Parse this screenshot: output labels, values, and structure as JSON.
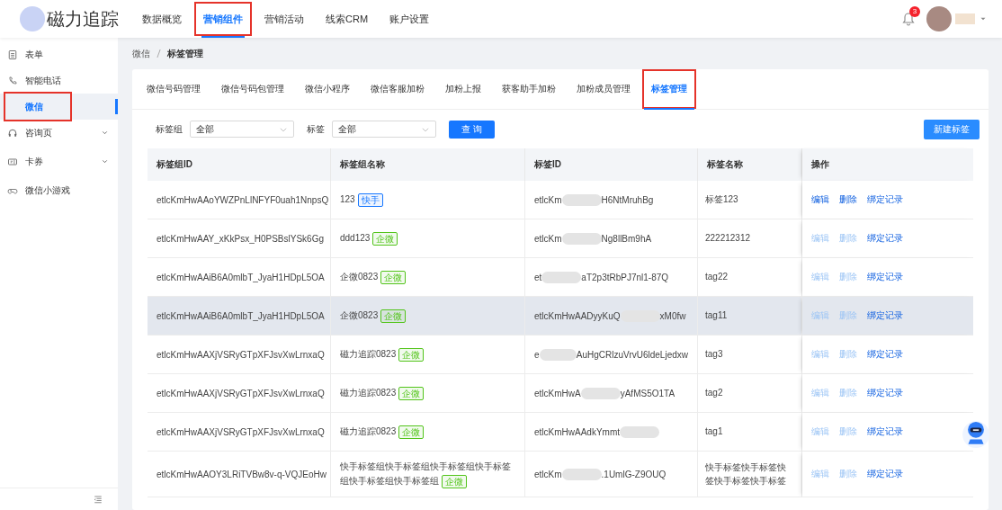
{
  "brand": {
    "name": "磁力追踪"
  },
  "nav": [
    {
      "label": "数据概览",
      "selected": false,
      "annotated": false
    },
    {
      "label": "营销组件",
      "selected": true,
      "annotated": true
    },
    {
      "label": "营销活动",
      "selected": false,
      "annotated": false
    },
    {
      "label": "线索CRM",
      "selected": false,
      "annotated": false
    },
    {
      "label": "账户设置",
      "selected": false,
      "annotated": false
    }
  ],
  "notifications": {
    "count": "3"
  },
  "sidebar": {
    "items": [
      {
        "kind": "item",
        "label": "表单",
        "selected": false,
        "annotated": false
      },
      {
        "kind": "item",
        "label": "智能电话",
        "selected": false,
        "annotated": false
      },
      {
        "kind": "item",
        "label": "微信",
        "selected": true,
        "annotated": true
      },
      {
        "kind": "group",
        "label": "咨询页",
        "selected": false,
        "expanded": false,
        "annotated": false
      },
      {
        "kind": "group",
        "label": "卡券",
        "selected": false,
        "expanded": false,
        "annotated": false
      },
      {
        "kind": "item",
        "label": "微信小游戏",
        "selected": false,
        "annotated": false
      }
    ]
  },
  "breadcrumb": [
    "微信",
    "标签管理"
  ],
  "tabs": [
    {
      "label": "微信号码管理",
      "selected": false,
      "annotated": false
    },
    {
      "label": "微信号码包管理",
      "selected": false,
      "annotated": false
    },
    {
      "label": "微信小程序",
      "selected": false,
      "annotated": false
    },
    {
      "label": "微信客服加粉",
      "selected": false,
      "annotated": false
    },
    {
      "label": "加粉上报",
      "selected": false,
      "annotated": false
    },
    {
      "label": "获客助手加粉",
      "selected": false,
      "annotated": false
    },
    {
      "label": "加粉成员管理",
      "selected": false,
      "annotated": false
    },
    {
      "label": "标签管理",
      "selected": true,
      "annotated": true
    }
  ],
  "filters": [
    {
      "label": "标签组",
      "value": "全部"
    },
    {
      "label": "标签",
      "value": "全部"
    }
  ],
  "query_button": "查 询",
  "new_button": "新建标签",
  "table": {
    "columns": [
      "标签组ID",
      "标签组名称",
      "标签ID",
      "标签名称",
      "操作"
    ],
    "rows": [
      {
        "hovered": false,
        "group_id": "etlcKmHwAAoYWZPnLlNFYF0uah1NnpsQ",
        "group_name": "123",
        "badge": {
          "text": "快手",
          "color": "#1677ff"
        },
        "tag_id": {
          "start": "etlcKm",
          "end": "H6NtMruhBg"
        },
        "tag_name": [
          "标签123"
        ],
        "actions": [
          {
            "label": "编辑",
            "disabled": false
          },
          {
            "label": "删除",
            "disabled": false
          },
          {
            "label": "绑定记录",
            "disabled": false
          }
        ]
      },
      {
        "hovered": false,
        "group_id": "etlcKmHwAAY_xKkPsx_H0PSBslYSk6Gg",
        "group_name": "ddd123",
        "badge": {
          "text": "企微",
          "color": "#52c41a"
        },
        "tag_id": {
          "start": "etlcKm",
          "end": "Ng8llBm9hA"
        },
        "tag_name": [
          "222212312"
        ],
        "actions": [
          {
            "label": "编辑",
            "disabled": true
          },
          {
            "label": "删除",
            "disabled": true
          },
          {
            "label": "绑定记录",
            "disabled": false
          }
        ]
      },
      {
        "hovered": false,
        "group_id": "etlcKmHwAAiB6A0mlbT_JyaH1HDpL5OA",
        "group_name": "企微0823",
        "badge": {
          "text": "企微",
          "color": "#52c41a"
        },
        "tag_id": {
          "start": "et",
          "end": "aT2p3tRbPJ7nl1-87Q"
        },
        "tag_name": [
          "tag22"
        ],
        "actions": [
          {
            "label": "编辑",
            "disabled": true
          },
          {
            "label": "删除",
            "disabled": true
          },
          {
            "label": "绑定记录",
            "disabled": false
          }
        ]
      },
      {
        "hovered": true,
        "group_id": "etlcKmHwAAiB6A0mlbT_JyaH1HDpL5OA",
        "group_name": "企微0823",
        "badge": {
          "text": "企微",
          "color": "#52c41a"
        },
        "tag_id": {
          "start": "etlcKmHwAADyyKuQ",
          "end": "xM0fw"
        },
        "tag_name": [
          "tag11"
        ],
        "actions": [
          {
            "label": "编辑",
            "disabled": true
          },
          {
            "label": "删除",
            "disabled": true
          },
          {
            "label": "绑定记录",
            "disabled": false
          }
        ]
      },
      {
        "hovered": false,
        "group_id": "etlcKmHwAAXjVSRyGTpXFJsvXwLrnxaQ",
        "group_name": "磁力追踪0823",
        "badge": {
          "text": "企微",
          "color": "#52c41a"
        },
        "tag_id": {
          "start": "e",
          "end": "AuHgCRlzuVrvU6ldeLjedxw"
        },
        "tag_name": [
          "tag3"
        ],
        "actions": [
          {
            "label": "编辑",
            "disabled": true
          },
          {
            "label": "删除",
            "disabled": true
          },
          {
            "label": "绑定记录",
            "disabled": false
          }
        ]
      },
      {
        "hovered": false,
        "group_id": "etlcKmHwAAXjVSRyGTpXFJsvXwLrnxaQ",
        "group_name": "磁力追踪0823",
        "badge": {
          "text": "企微",
          "color": "#52c41a"
        },
        "tag_id": {
          "start": "etlcKmHwA",
          "end": "yAfMS5O1TA"
        },
        "tag_name": [
          "tag2"
        ],
        "actions": [
          {
            "label": "编辑",
            "disabled": true
          },
          {
            "label": "删除",
            "disabled": true
          },
          {
            "label": "绑定记录",
            "disabled": false
          }
        ]
      },
      {
        "hovered": false,
        "group_id": "etlcKmHwAAXjVSRyGTpXFJsvXwLrnxaQ",
        "group_name": "磁力追踪0823",
        "badge": {
          "text": "企微",
          "color": "#52c41a"
        },
        "tag_id": {
          "start": "etlcKmHwAAdkYmmt"
        },
        "tag_name": [
          "tag1"
        ],
        "actions": [
          {
            "label": "编辑",
            "disabled": true
          },
          {
            "label": "删除",
            "disabled": true
          },
          {
            "label": "绑定记录",
            "disabled": false
          }
        ]
      },
      {
        "hovered": false,
        "group_id": "etlcKmHwAAOY3LRiTVBw8v-q-VQJEoHw",
        "group_name": "快手标签组快手标签组快手标签组快手标签组快手标签组快手标签组",
        "badge": {
          "text": "企微",
          "color": "#52c41a"
        },
        "tag_id": {
          "start": "etlcKm",
          "end": ".1UmlG-Z9OUQ"
        },
        "tag_name": [
          "快手标签快手标签快",
          "签快手标签快手标签"
        ],
        "actions": [
          {
            "label": "编辑",
            "disabled": true
          },
          {
            "label": "删除",
            "disabled": true
          },
          {
            "label": "绑定记录",
            "disabled": false
          }
        ]
      }
    ]
  }
}
